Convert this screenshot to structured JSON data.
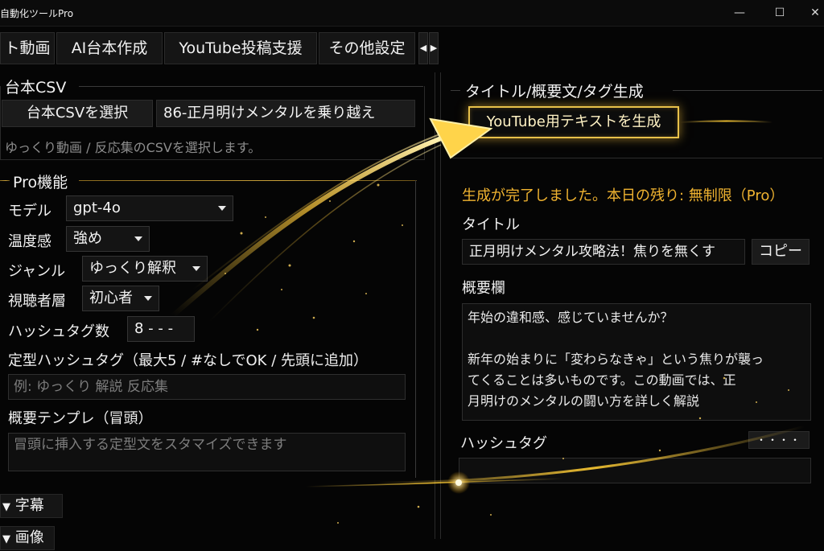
{
  "window": {
    "title": "自動化ツールPro",
    "controls": {
      "minimize": "—",
      "maximize": "☐",
      "close": "✕"
    }
  },
  "tabs": [
    {
      "label": "ト動画"
    },
    {
      "label": "AI台本作成"
    },
    {
      "label": "YouTube投稿支援"
    },
    {
      "label": "その他設定"
    }
  ],
  "left": {
    "csv_section": {
      "title": "台本CSV",
      "select_button": "台本CSVを選択",
      "selected_file": "86-正月明けメンタルを乗り越え",
      "hint": "ゆっくり動画 / 反応集のCSVを選択します。"
    },
    "pro_section": {
      "title": "Pro機能",
      "model_label": "モデル",
      "model_value": "gpt-4o",
      "temperature_label": "温度感",
      "temperature_value": "強め",
      "genre_label": "ジャンル",
      "genre_value": "ゆっくり解釈",
      "audience_label": "視聴者層",
      "audience_value": "初心者",
      "hashtag_count_label": "ハッシュタグ数",
      "hashtag_count_value": "8 - - -",
      "fixed_hashtag_label": "定型ハッシュタグ（最大5 / #なしでOK / 先頭に追加）",
      "fixed_hashtag_placeholder": "例: ゆっくり 解説 反応集",
      "template_label": "概要テンプレ（冒頭）",
      "template_placeholder": "冒頭に挿入する定型文をスタマイズできます"
    },
    "collapsibles": [
      {
        "label": "字幕",
        "icon": "triangle-down-icon"
      },
      {
        "label": "画像",
        "icon": "triangle-down-icon"
      }
    ]
  },
  "right": {
    "section_title": "タイトル/概要文/タグ生成",
    "generate_button": "YouTube用テキストを生成",
    "status": "生成が完了しました。本日の残り: 無制限（Pro）",
    "title_label": "タイトル",
    "title_value": "正月明けメンタル攻略法！焦りを無くす",
    "copy_button": "コピー",
    "description_label": "概要欄",
    "description_lines": [
      "年始の違和感、感じていませんか？",
      "",
      "新年の始まりに「変わらなきゃ」という焦りが襲っ",
      "てくることは多いものです。この動画では、正",
      "月明けのメンタルの闘い方を詳しく解説"
    ],
    "hashtag_label": "ハッシュタグ",
    "hashtag_button": "・・・・",
    "hashtag_value": ""
  },
  "colors": {
    "accent_gold": "#e8c14a",
    "status_orange": "#f0b330",
    "background": "#050505"
  }
}
